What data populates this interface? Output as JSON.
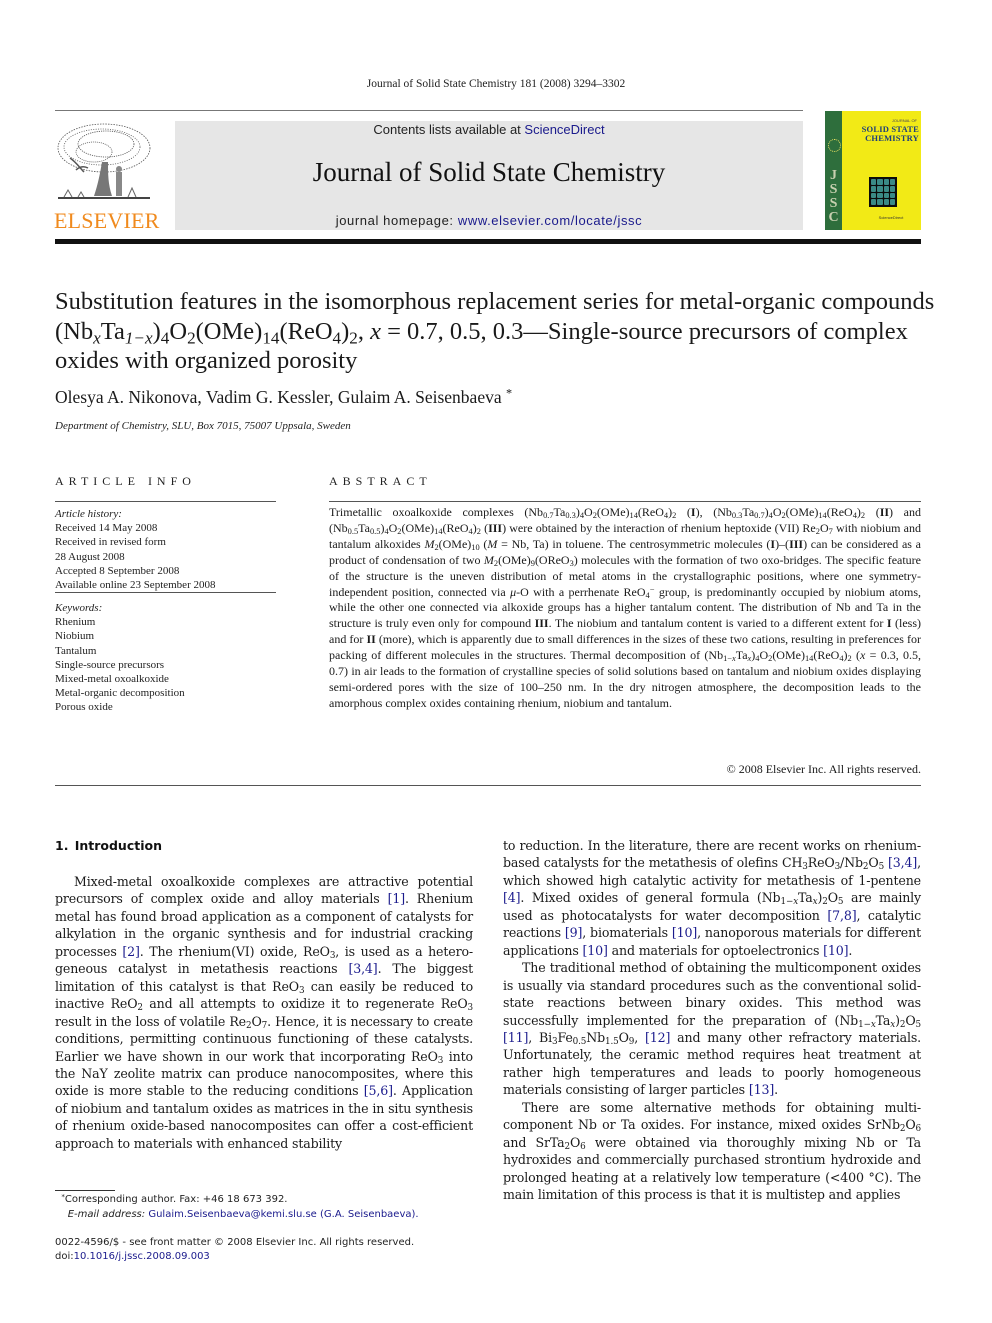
{
  "running_head": "Journal of Solid State Chemistry 181 (2008) 3294–3302",
  "publisher": {
    "logo_word": "ELSEVIER",
    "logo_color": "#f08a1d",
    "logo_icon": "tree-icon"
  },
  "masthead": {
    "contents_prefix": "Contents lists available at ",
    "contents_link": "ScienceDirect",
    "journal_title": "Journal of Solid State Chemistry",
    "homepage_prefix": "journal homepage: ",
    "homepage_link": "www.elsevier.com/locate/jssc",
    "link_color": "#1a1a8c",
    "background": "#e6e6e6"
  },
  "cover": {
    "kicker": "JOURNAL OF",
    "title_line1": "SOLID STATE",
    "title_line2": "CHEMISTRY",
    "spine_letters": [
      "J",
      "S",
      "S",
      "C"
    ],
    "footer": "ScienceDirect",
    "colors": {
      "background": "#f2ea16",
      "spine": "#2e6e3c",
      "title": "#1d3f7a"
    }
  },
  "article": {
    "title_part1": "Substitution features in the isomorphous replacement series for metal-organic compounds (Nb",
    "title_formula": {
      "x": "x",
      "ta": "Ta",
      "one_minus_x": "1−x",
      "close": ")",
      "four": "4",
      "o": "O",
      "two": "2",
      "ome": "(OMe)",
      "fourteen": "14",
      "reo": "(ReO",
      "four_b": "4",
      "close2": ")",
      "two_b": "2"
    },
    "title_part2": ", ",
    "title_x": "x",
    "title_part3": " = 0.7, 0.5, 0.3—Single-source precursors of complex oxides with organized porosity",
    "authors": "Olesya A. Nikonova, Vadim G. Kessler, Gulaim A. Seisenbaeva",
    "author_mark": "*",
    "affiliation": "Department of Chemistry, SLU, Box 7015, 75007 Uppsala, Sweden"
  },
  "article_info": {
    "heading": "ARTICLE INFO",
    "history_label": "Article history:",
    "history": [
      "Received 14 May 2008",
      "Received in revised form",
      "28 August 2008",
      "Accepted 8 September 2008",
      "Available online 23 September 2008"
    ],
    "keywords_label": "Keywords:",
    "keywords": [
      "Rhenium",
      "Niobium",
      "Tantalum",
      "Single-source precursors",
      "Mixed-metal oxoalkoxide",
      "Metal-organic decomposition",
      "Porous oxide"
    ]
  },
  "abstract": {
    "heading": "ABSTRACT",
    "copyright": "© 2008 Elsevier Inc. All rights reserved."
  },
  "introduction": {
    "heading": "1. Introduction",
    "citations": [
      "[1]",
      "[2]",
      "[3,4]",
      "[5,6]",
      "[3,4]",
      "[4]",
      "[7,8]",
      "[9]",
      "[10]",
      "[10]",
      "[10]",
      "[11]",
      "[12]",
      "[13]"
    ]
  },
  "footnote": {
    "mark": "*",
    "corresponding": "Corresponding author. Fax: +46 18 673 392.",
    "email_label": "E-mail address:",
    "email": "Gulaim.Seisenbaeva@kemi.slu.se (G.A. Seisenbaeva).",
    "issn": "0022-4596/$ - see front matter © 2008 Elsevier Inc. All rights reserved.",
    "doi_label": "doi:",
    "doi": "10.1016/j.jssc.2008.09.003"
  }
}
